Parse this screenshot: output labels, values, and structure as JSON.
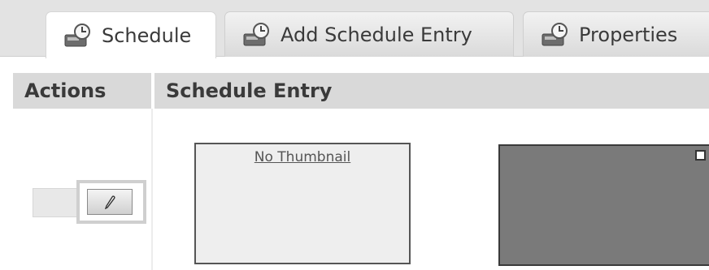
{
  "tabs": [
    {
      "label": "Schedule",
      "icon": "schedule-disk-icon",
      "active": true
    },
    {
      "label": "Add Schedule Entry",
      "icon": "schedule-disk-icon",
      "active": false
    },
    {
      "label": "Properties",
      "icon": "schedule-disk-icon",
      "active": false
    }
  ],
  "table": {
    "headers": {
      "actions": "Actions",
      "entry": "Schedule Entry"
    },
    "row": {
      "edit_icon": "pencil-icon",
      "thumbnail_text": "No Thumbnail"
    }
  },
  "colors": {
    "header_bg": "#d9d9d9",
    "tab_bg": "#e3e3e3",
    "preview_bg": "#7a7a7a"
  }
}
